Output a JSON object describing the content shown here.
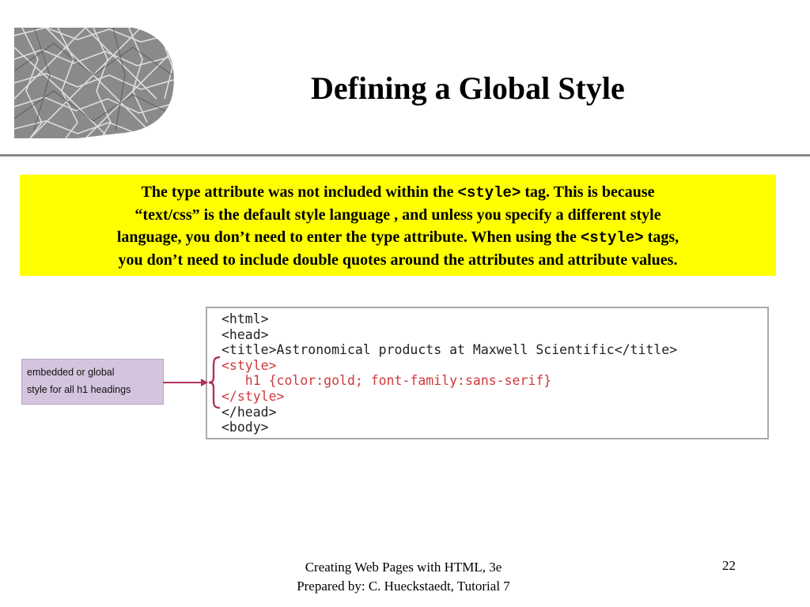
{
  "slide": {
    "title": "Defining a Global Style"
  },
  "callout": {
    "line1_pre": "The type attribute was not included within the ",
    "line1_code": "<style>",
    "line1_post": " tag.  This is because",
    "line2": "“text/css” is the default style language , and unless you specify a different style",
    "line3_pre": "language, you don’t need to enter the type attribute.  When using the ",
    "line3_code": "<style>",
    "line3_post": " tags,",
    "line4": "you don’t need to include double quotes around the attributes and attribute values."
  },
  "code_example": {
    "lines": [
      {
        "text": "<html>",
        "highlight": false
      },
      {
        "text": "<head>",
        "highlight": false
      },
      {
        "text": "<title>Astronomical products at Maxwell Scientific</title>",
        "highlight": false
      },
      {
        "text": "<style>",
        "highlight": true
      },
      {
        "text": "   h1 {color:gold; font-family:sans-serif}",
        "highlight": true
      },
      {
        "text": "</style>",
        "highlight": true
      },
      {
        "text": "</head>",
        "highlight": false
      },
      {
        "text": "<body>",
        "highlight": false
      }
    ],
    "highlight_color": "#d0383a"
  },
  "annotation": {
    "line1": "embedded or global",
    "line2": "style for all h1 headings"
  },
  "footer": {
    "line1": "Creating Web Pages with HTML, 3e",
    "line2": "Prepared by: C. Hueckstaedt, Tutorial 7",
    "page_number": "22"
  },
  "colors": {
    "callout_background": "#ffff00",
    "annotation_background": "#d4c4dd",
    "arrow": "#b03060",
    "rule": "#888888"
  }
}
